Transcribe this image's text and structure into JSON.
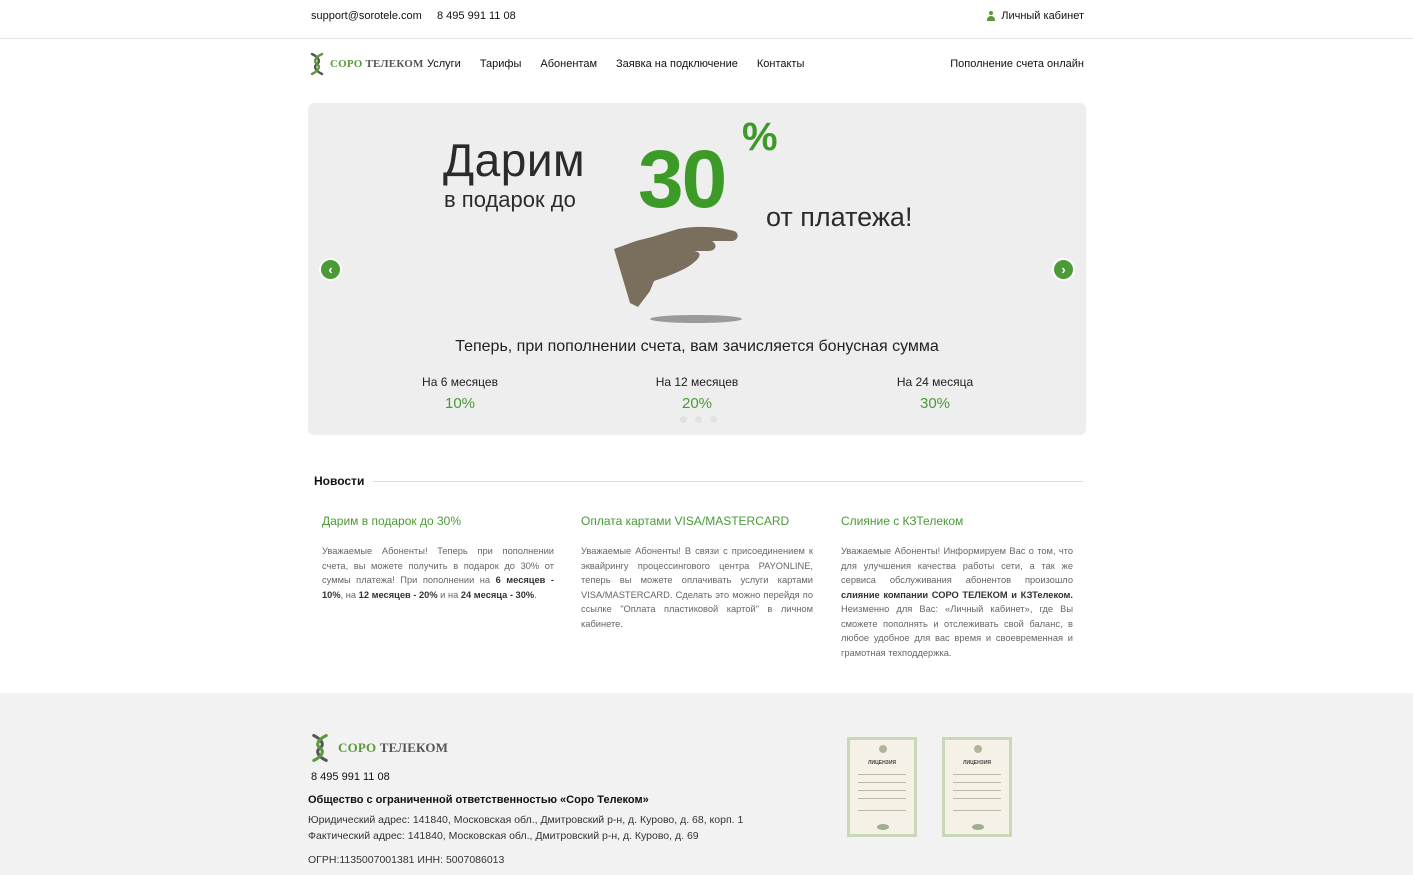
{
  "topbar": {
    "email": "support@sorotele.com",
    "phone": "8 495 991 11 08",
    "cabinet_label": "Личный кабинет",
    "cabinet_icon": "user-icon"
  },
  "brand": {
    "name_first": "СОРО",
    "name_second": "ТЕЛЕКОМ",
    "color": "#5a9a3a"
  },
  "nav": {
    "items": [
      "Услуги",
      "Тарифы",
      "Абонентам",
      "Заявка на подключение",
      "Контакты"
    ],
    "pay_online": "Пополнение счета онлайн"
  },
  "slider": {
    "headline_1": "Дарим",
    "headline_2": "в подарок до",
    "big_number": "30",
    "percent_sign": "%",
    "headline_3": "от платежа!",
    "subtitle": "Теперь, при пополнении счета, вам зачисляется бонусная сумма",
    "plans": [
      {
        "term": "На 6 месяцев",
        "bonus": "10%"
      },
      {
        "term": "На 12 месяцев",
        "bonus": "20%"
      },
      {
        "term": "На 24 месяца",
        "bonus": "30%"
      }
    ],
    "accent_color": "#3c9a26",
    "prev_icon": "chevron-left-icon",
    "next_icon": "chevron-right-icon"
  },
  "news": {
    "heading": "Новости",
    "items": [
      {
        "title": "Дарим в подарок до 30%",
        "p1": "Уважаемые Абоненты! Теперь при пополнении счета, вы можете получить в подарок до 30% от суммы платежа! При пополнении на ",
        "b1": "6 месяцев - 10%",
        "p2": ", на ",
        "b2": "12 месяцев - 20%",
        "p3": " и на ",
        "b3": "24 месяца - 30%",
        "p4": "."
      },
      {
        "title": "Оплата картами VISA/MASTERCARD",
        "text": "Уважаемые Абоненты! В связи с присоединением к эквайрингу процессингового центра PAYONLINE, теперь вы можете оплачивать услуги картами VISA/MASTERCARD. Сделать это можно перейдя по ссылке \"Оплата пластиковой картой\" в личном кабинете."
      },
      {
        "title": "Слияние с КЗТелеком",
        "p1": "Уважаемые Абоненты! Информируем Вас о том, что для улучшения качества работы сети, а так же сервиса обслуживания абонентов произошло ",
        "b1": "слияние компании СОРО ТЕЛЕКОМ и КЗТелеком.",
        "p2": " Неизменно для Вас: «Личный кабинет», где Вы сможете пополнять и отслеживать свой баланс, в любое удобное для вас время и своевременная и грамотная техподдержка."
      }
    ]
  },
  "footer": {
    "phone": "8 495 991 11 08",
    "company": "Общество с ограниченной ответственностью «Соро Телеком»",
    "legal_address": "Юридический адрес: 141840, Московская обл., Дмитровский р-н, д. Курово, д. 68, корп. 1",
    "actual_address": "Фактический адрес: 141840, Московская обл., Дмитровский р-н, д. Курово, д. 69",
    "ids": "ОГРН:1135007001381 ИНН: 5007086013",
    "license_title": "ЛИЦЕНЗИЯ"
  }
}
